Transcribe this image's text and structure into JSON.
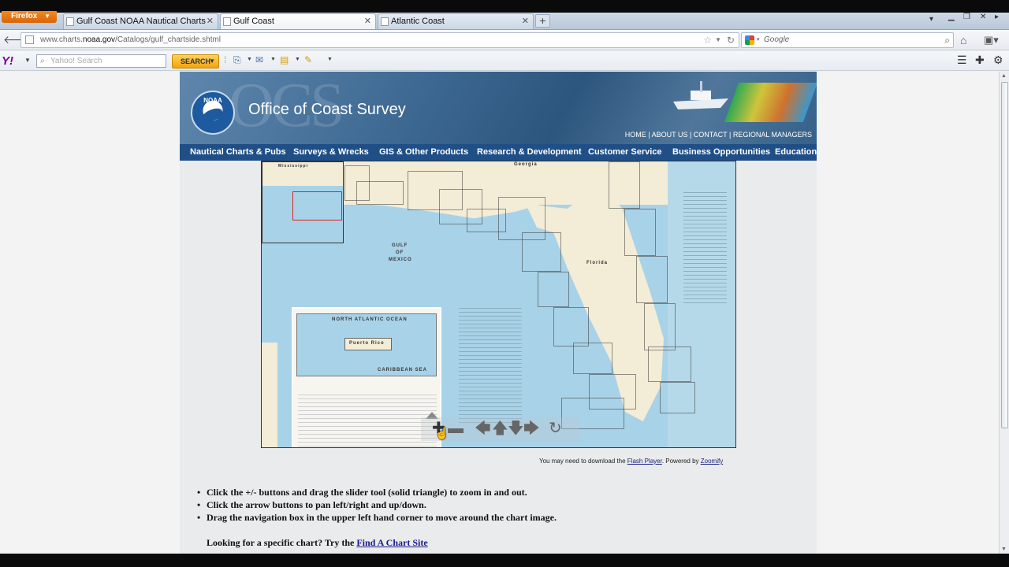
{
  "browser": {
    "app_button": "Firefox",
    "tabs": [
      {
        "title": "Gulf Coast NOAA Nautical Charts"
      },
      {
        "title": "Gulf Coast"
      },
      {
        "title": "Atlantic Coast"
      }
    ],
    "new_tab": "+",
    "url_prefix": "www.charts.",
    "url_domain": "noaa.gov",
    "url_path": "/Catalogs/gulf_chartside.shtml",
    "search_placeholder": "Google"
  },
  "yahoo_toolbar": {
    "search_placeholder": "Yahoo! Search",
    "search_button": "SEARCH"
  },
  "page": {
    "banner_title": "Office of Coast Survey",
    "watermark": "OCS",
    "logo_text": "NOAA",
    "top_links": [
      "HOME",
      "ABOUT US",
      "CONTACT",
      "REGIONAL MANAGERS"
    ],
    "nav": [
      "Nautical Charts & Pubs",
      "Surveys & Wrecks",
      "GIS & Other Products",
      "Research & Development",
      "Customer Service",
      "Business Opportunities",
      "Education"
    ],
    "map_labels": {
      "georgia": "Georgia",
      "gulf": "GULF",
      "of": "OF",
      "mexico": "MEXICO",
      "florida": "Florida",
      "mississippi": "Mississippi",
      "north_atlantic": "NORTH ATLANTIC OCEAN",
      "puerto_rico": "Puerto Rico",
      "caribbean": "CARIBBEAN SEA"
    },
    "powered_prefix": "You may need to download the ",
    "flash_link": "Flash Player",
    "powered_mid": ". Powered by ",
    "zoomify_link": "Zoomify",
    "instructions": [
      "Click the +/- buttons and drag the slider tool (solid triangle) to zoom in and out.",
      "Click the arrow buttons to pan left/right and up/down.",
      "Drag the navigation box in the upper left hand corner to move around the chart image."
    ],
    "look_prefix": "Looking for a specific chart? Try the ",
    "find_link": "Find A Chart Site"
  },
  "colors": {
    "nav_bar": "#1f4f86",
    "water": "#a8d2e8",
    "land": "#f3ecd6"
  }
}
